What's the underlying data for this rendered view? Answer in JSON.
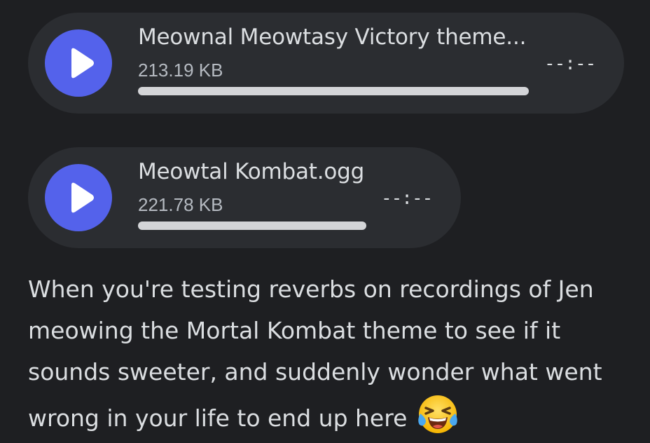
{
  "attachments": [
    {
      "title": "Meownal Meowtasy Victory theme...",
      "size": "213.19 KB",
      "time": "--:--",
      "progress": 0,
      "icon": "play-icon"
    },
    {
      "title": "Meowtal Kombat.ogg",
      "size": "221.78 KB",
      "time": "--:--",
      "progress": 0,
      "icon": "play-icon"
    }
  ],
  "message": {
    "text": "When you're testing reverbs on recordings of Jen meowing the Mortal Kombat theme to see if it sounds sweeter, and suddenly wonder what went wrong in your life to end up here",
    "emoji": "face-with-tears-of-joy-icon"
  },
  "colors": {
    "background": "#1e1f22",
    "player_bg": "#2b2d31",
    "accent": "#5462eb",
    "text": "#dbdee1",
    "muted_text": "#b5bac1",
    "track": "#d4d5d8"
  }
}
